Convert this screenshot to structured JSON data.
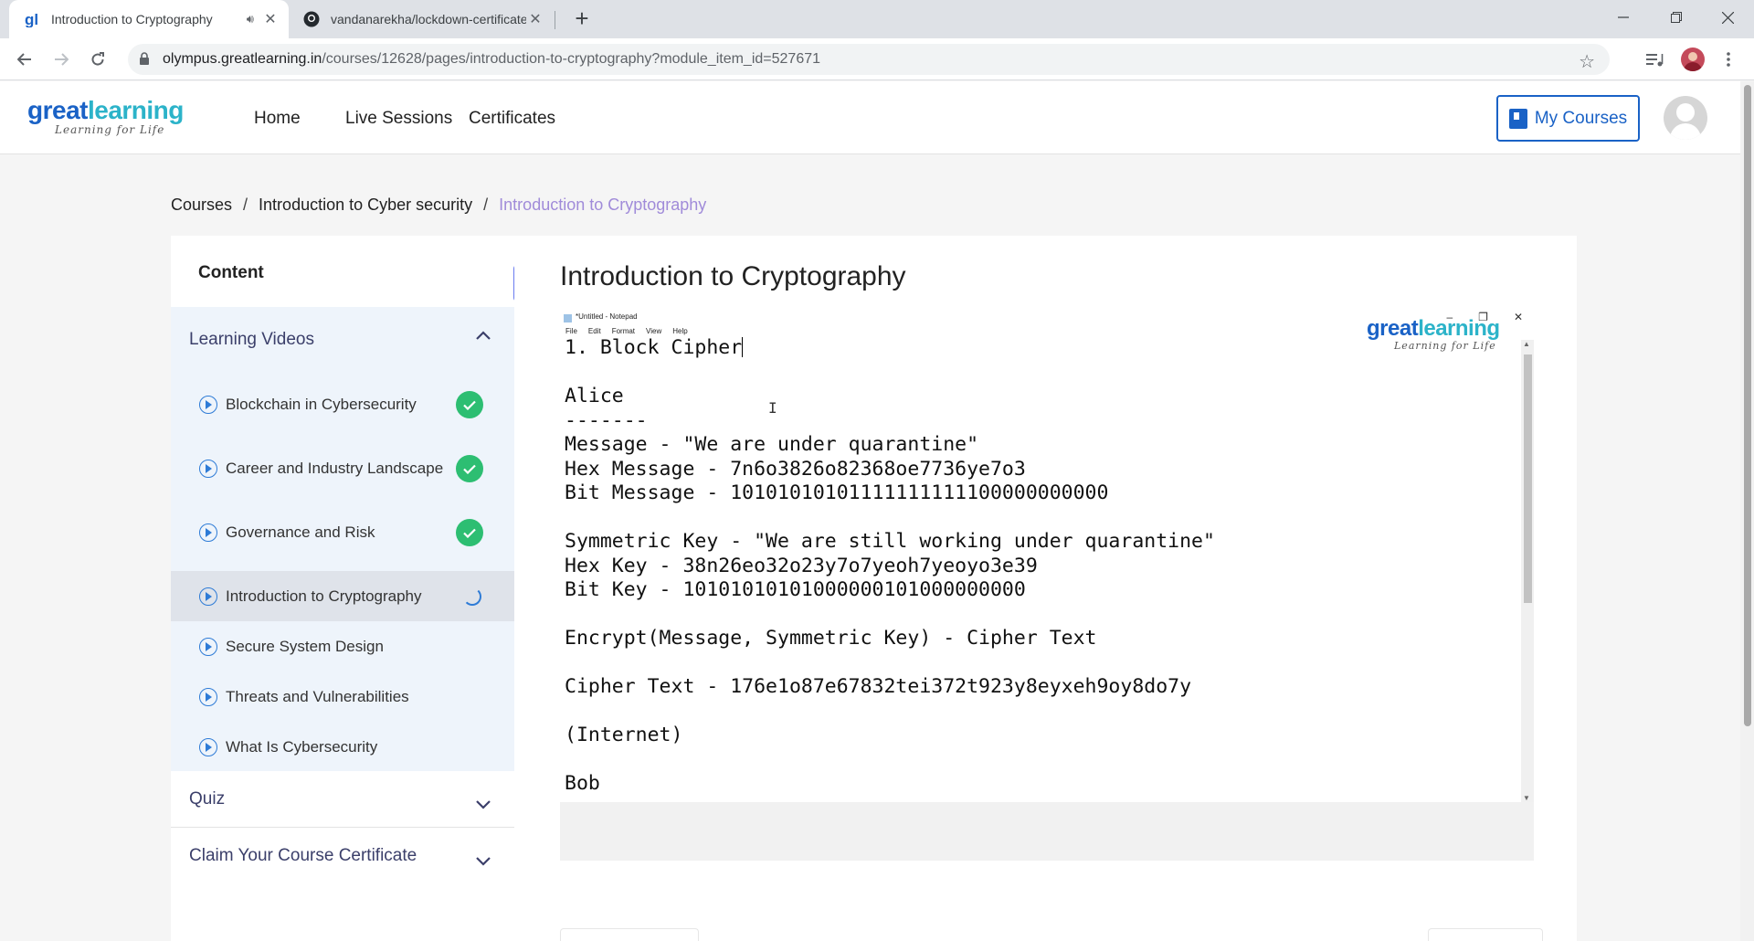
{
  "browser": {
    "tabs": [
      {
        "title": "Introduction to Cryptography",
        "active": true,
        "audio": true
      },
      {
        "title": "vandanarekha/lockdown-certificates",
        "active": false
      }
    ],
    "url_host": "olympus.greatlearning.in",
    "url_path": "/courses/12628/pages/introduction-to-cryptography?module_item_id=527671"
  },
  "header": {
    "logo_great": "great",
    "logo_learning": "learning",
    "logo_tagline": "Learning for Life",
    "nav": [
      "Home",
      "Live Sessions",
      "Certificates"
    ],
    "my_courses_label": "My Courses"
  },
  "breadcrumb": {
    "items": [
      "Courses",
      "Introduction to Cyber security"
    ],
    "separator": "/",
    "current": "Introduction to Cryptography"
  },
  "sidebar": {
    "content_title": "Content",
    "sections": {
      "learning_videos": "Learning Videos",
      "quiz": "Quiz",
      "certificate": "Claim Your Course Certificate"
    },
    "videos": [
      {
        "label": "Blockchain in Cybersecurity",
        "status": "completed"
      },
      {
        "label": "Career and Industry Landscape",
        "status": "completed"
      },
      {
        "label": "Governance and Risk",
        "status": "completed"
      },
      {
        "label": "Introduction to Cryptography",
        "status": "in-progress"
      },
      {
        "label": "Secure System Design",
        "status": "none"
      },
      {
        "label": "Threats and Vulnerabilities",
        "status": "none"
      },
      {
        "label": "What Is Cybersecurity",
        "status": "none"
      }
    ]
  },
  "main": {
    "title": "Introduction to Cryptography",
    "video": {
      "notepad_title": "*Untitled - Notepad",
      "notepad_menu": [
        "File",
        "Edit",
        "Format",
        "View",
        "Help"
      ],
      "lines": [
        "1. Block Cipher",
        "",
        "Alice",
        "-------",
        "Message - \"We are under quarantine\"",
        "Hex Message - 7n6o3826o82368oe7736ye7o3",
        "Bit Message - 10101010101111111111100000000000",
        "",
        "Symmetric Key - \"We are still working under quarantine\"",
        "Hex Key - 38n26eo32o23y7o7yeoh7yeoyo3e39",
        "Bit Key - 10101010101000000101000000000",
        "",
        "Encrypt(Message, Symmetric Key) - Cipher Text",
        "",
        "Cipher Text - 176e1o87e67832tei372t923y8eyxeh9oy8do7y",
        "",
        "(Internet)",
        "",
        "Bob"
      ]
    }
  },
  "colors": {
    "brand_blue": "#1a62c6",
    "brand_teal": "#2cb3c9",
    "breadcrumb_current": "#a08bd9",
    "completed_green": "#2dbe72",
    "collapse_button": "#6b7cf0"
  }
}
